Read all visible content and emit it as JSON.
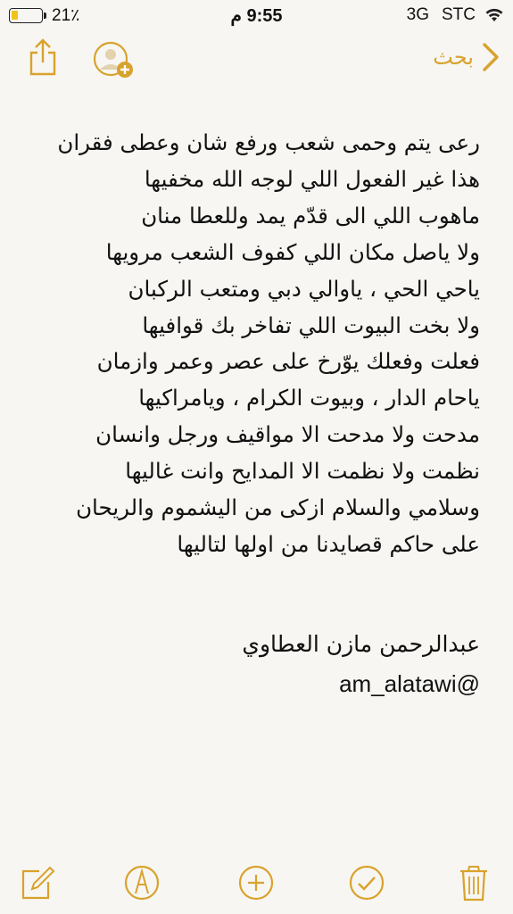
{
  "status_bar": {
    "battery_percent": "21٪",
    "battery_level": 0.21,
    "battery_color": "#f0c419",
    "time": "9:55 م",
    "network": "3G",
    "carrier": "STC",
    "wifi_icon": "wifi-icon"
  },
  "nav": {
    "back_label": "بحث",
    "back_icon": "chevron-right-icon",
    "share_icon": "share-icon",
    "collaborate_icon": "add-person-icon",
    "accent_color": "#d9a22d"
  },
  "note": {
    "lines": [
      "رعى يتم وحمى شعب ورفع شان وعطى فقران",
      "هذا غير الفعول اللي لوجه الله مخفيها",
      "ماهوب اللي الى قدّم يمد وللعطا منان",
      "ولا ياصل مكان اللي كفوف الشعب مرويها",
      "ياحي الحي ، ياوالي دبي ومتعب الركبان",
      "ولا بخت البيوت اللي تفاخر بك قوافيها",
      "فعلت وفعلك يوّرخ على عصر وعمر وازمان",
      "ياحام الدار ، وبيوت الكرام ، ويامراكيها",
      "مدحت ولا مدحت الا مواقيف ورجل وانسان",
      "نظمت ولا نظمت الا المدايح وانت غاليها",
      "وسلامي والسلام ازكى من اليشموم والريحان",
      "على حاكم قصايدنا من اولها لتاليها"
    ],
    "signature": "عبدالرحمن مازن العطاوي",
    "handle": "am_alatawi@"
  },
  "toolbar": {
    "compose_icon": "compose-icon",
    "markup_icon": "pen-markup-icon",
    "add_icon": "plus-circle-icon",
    "checklist_icon": "checkmark-circle-icon",
    "trash_icon": "trash-icon"
  }
}
